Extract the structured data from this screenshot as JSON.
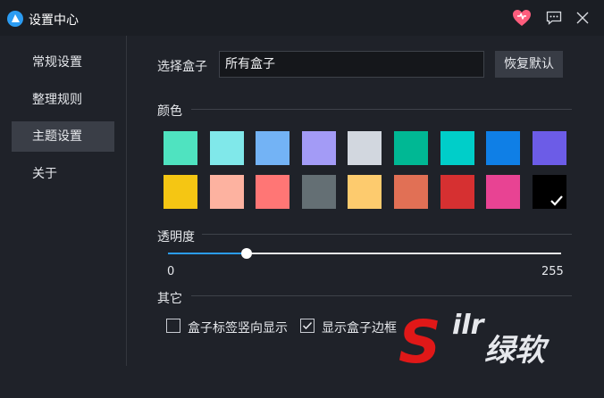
{
  "window": {
    "title": "设置中心"
  },
  "sidebar": {
    "items": [
      {
        "label": "常规设置",
        "active": false
      },
      {
        "label": "整理规则",
        "active": false
      },
      {
        "label": "主题设置",
        "active": true
      },
      {
        "label": "关于",
        "active": false
      }
    ]
  },
  "box_select": {
    "label": "选择盒子",
    "value": "所有盒子",
    "reset_label": "恢复默认"
  },
  "color": {
    "label": "颜色",
    "selected": "#000000",
    "swatches": [
      "#4fe3c0",
      "#80e8ea",
      "#73b3f5",
      "#a39bf6",
      "#d2d7df",
      "#00b894",
      "#00cec9",
      "#0f7fe6",
      "#6c5ce7",
      "#f5c613",
      "#fdb2a0",
      "#ff7675",
      "#646f74",
      "#fdcb6e",
      "#e17055",
      "#d63031",
      "#e84393",
      "#000000"
    ]
  },
  "transparency": {
    "label": "透明度",
    "min": "0",
    "max": "255",
    "value": 0.2,
    "accent": "#2b9cf2"
  },
  "other": {
    "label": "其它",
    "options": [
      {
        "label": "盒子标签竖向显示",
        "checked": false
      },
      {
        "label": "显示盒子边框",
        "checked": true
      }
    ]
  },
  "watermark": {
    "glyph": "S",
    "letters": "ilr",
    "text": "绿软"
  }
}
